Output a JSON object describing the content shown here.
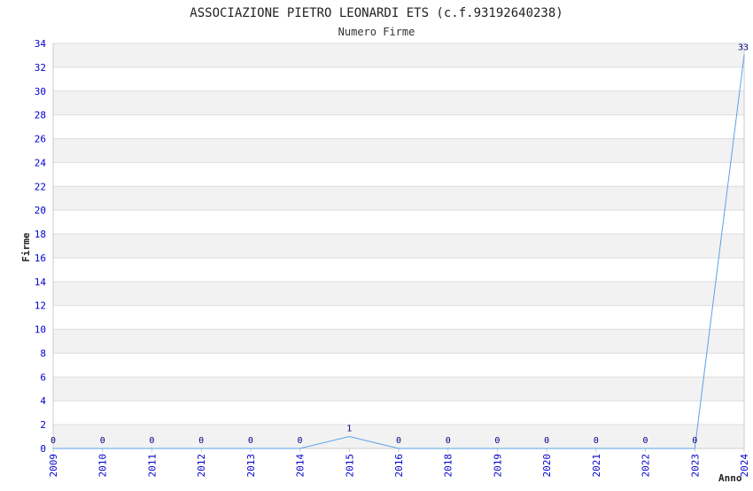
{
  "chart_data": {
    "type": "line",
    "title": "ASSOCIAZIONE PIETRO LEONARDI ETS (c.f.93192640238)",
    "subtitle": "Numero Firme",
    "xlabel": "Anno",
    "ylabel": "Firme",
    "categories": [
      "2009",
      "2010",
      "2011",
      "2012",
      "2013",
      "2014",
      "2015",
      "2016",
      "2018",
      "2019",
      "2020",
      "2021",
      "2022",
      "2023",
      "2024"
    ],
    "values": [
      0,
      0,
      0,
      0,
      0,
      0,
      1,
      0,
      0,
      0,
      0,
      0,
      0,
      0,
      33
    ],
    "data_labels": [
      "0",
      "0",
      "0",
      "0",
      "0",
      "0",
      "1",
      "0",
      "0",
      "0",
      "0",
      "0",
      "0",
      "0",
      "33"
    ],
    "y_ticks": [
      "0",
      "2",
      "4",
      "6",
      "8",
      "10",
      "12",
      "14",
      "16",
      "18",
      "20",
      "22",
      "24",
      "26",
      "28",
      "30",
      "32",
      "34"
    ],
    "ylim": [
      0,
      34
    ],
    "grid": true,
    "colors": {
      "line": "#5aa2ea",
      "tick_text": "#0000cc",
      "band": "#f2f2f2",
      "gridline": "#dddddd",
      "axis": "#cccccc"
    }
  }
}
